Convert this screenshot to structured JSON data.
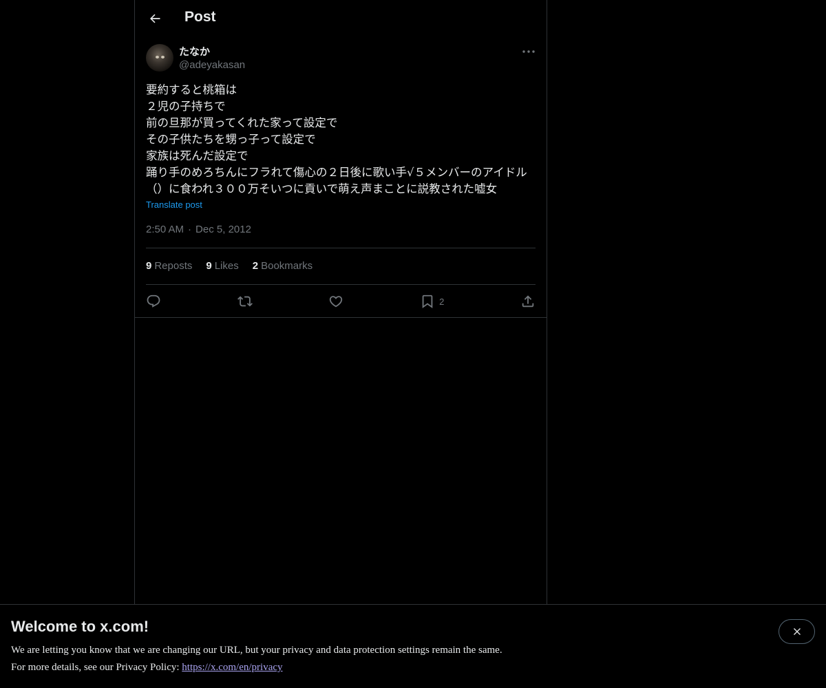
{
  "header": {
    "title": "Post"
  },
  "post": {
    "display_name": "たなか",
    "handle": "@adeyakasan",
    "text": "要約すると桃箱は\n２児の子持ちで\n前の旦那が買ってくれた家って設定で\nその子供たちを甥っ子って設定で\n家族は死んだ設定で\n踊り手のめろちんにフラれて傷心の２日後に歌い手√５メンバーのアイドル（）に食われ３００万そいつに貢いで萌え声まことに説教された嘘女",
    "translate_label": "Translate post",
    "time": "2:50 AM",
    "separator": "·",
    "date": "Dec 5, 2012"
  },
  "stats": {
    "reposts_count": "9",
    "reposts_label": "Reposts",
    "likes_count": "9",
    "likes_label": "Likes",
    "bookmarks_count": "2",
    "bookmarks_label": "Bookmarks"
  },
  "actions": {
    "reply_icon": "reply-icon",
    "repost_icon": "repost-icon",
    "like_icon": "heart-icon",
    "bookmark_icon": "bookmark-icon",
    "bookmark_count": "2",
    "share_icon": "share-icon"
  },
  "banner": {
    "title": "Welcome to x.com!",
    "line1": "We are letting you know that we are changing our URL, but your privacy and data protection settings remain the same.",
    "line2_prefix": "For more details, see our Privacy Policy: ",
    "link": "https://x.com/en/privacy"
  },
  "colors": {
    "background": "#000000",
    "text_primary": "#e7e9ea",
    "text_secondary": "#71767b",
    "accent": "#1d9bf0",
    "border": "#2f3336"
  }
}
